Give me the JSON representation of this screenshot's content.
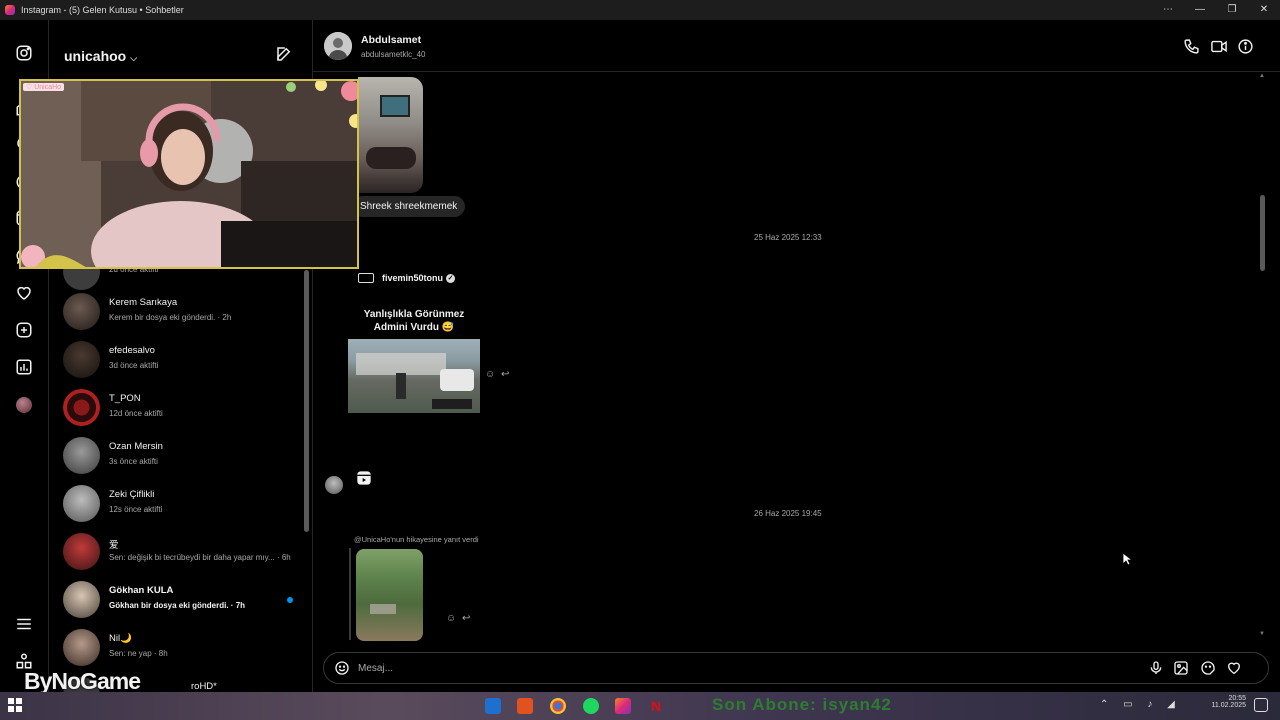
{
  "window": {
    "title": "Instagram - (5) Gelen Kutusu • Sohbetler",
    "controls": [
      "⋯",
      "—",
      "❐",
      "✕"
    ]
  },
  "rail": {
    "icons": [
      "instagram-icon",
      "home-icon",
      "search-icon",
      "explore-icon",
      "reels-icon",
      "messenger-icon",
      "heart-icon",
      "create-icon",
      "insights-icon",
      "profile-avatar",
      "menu-icon",
      "apps-icon"
    ]
  },
  "sidebar": {
    "username": "unicahoo",
    "conversations": [
      {
        "name": "",
        "status": "2d önce aktifti",
        "unread": false
      },
      {
        "name": "Kerem Sarıkaya",
        "status": "Kerem bir dosya eki gönderdi. · 2h",
        "unread": false
      },
      {
        "name": "efedesalvo",
        "status": "3d önce aktifti",
        "unread": false
      },
      {
        "name": "T_PON",
        "status": "12d önce aktifti",
        "unread": false
      },
      {
        "name": "Ozan Mersin",
        "status": "3s önce aktifti",
        "unread": false
      },
      {
        "name": "Zeki Çiflikli",
        "status": "12s önce aktifti",
        "unread": false
      },
      {
        "name": "爱",
        "status": "Sen: değişik bi tecrübeydi bir daha yapar mıy... · 6h",
        "unread": false
      },
      {
        "name": "Gökhan KULA",
        "status": "Gökhan bir dosya eki gönderdi. · 7h",
        "unread": true
      },
      {
        "name": "Nil🌙",
        "status": "Sen: ne yap · 8h",
        "unread": false
      },
      {
        "name": "roHD*",
        "status": "",
        "unread": false
      }
    ]
  },
  "chat": {
    "contact_name": "Abdulsamet",
    "contact_handle": "abdulsametklc_40",
    "messages": {
      "bubble_text": "Shreek shreekmemek",
      "timestamp_1": "25 Haz 2025 12:33",
      "share_account": "fivemin50tonu",
      "share_title_line1": "Yanlışlıkla Görünmez",
      "share_title_line2": "Admini Vurdu 😅",
      "timestamp_2": "26 Haz 2025 19:45",
      "story_reply_label": "@UnicaHo'nun hikayesine yanıt verdi"
    },
    "input_placeholder": "Mesaj..."
  },
  "overlay": {
    "webcam_tag": "♡ UnicaHo",
    "watermark": "ByNoGame"
  },
  "taskbar": {
    "overlay_text": "Son Abone: isyan42",
    "time": "20:55",
    "date": "11.02.2025"
  },
  "colors": {
    "background": "#000000",
    "border": "#262626",
    "accent_blue": "#0095f6",
    "muted_text": "#a8a8a8"
  }
}
